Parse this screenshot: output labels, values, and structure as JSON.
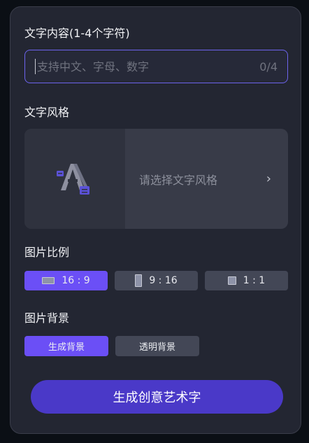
{
  "text_content": {
    "label": "文字内容(1-4个字符)",
    "placeholder": "支持中文、字母、数字",
    "value": "",
    "counter": "0/4"
  },
  "text_style": {
    "label": "文字风格",
    "placeholder": "请选择文字风格",
    "chevron": "›"
  },
  "image_ratio": {
    "label": "图片比例",
    "options": [
      {
        "label": "16 : 9",
        "selected": true
      },
      {
        "label": "9 : 16",
        "selected": false
      },
      {
        "label": "1 : 1",
        "selected": false
      }
    ]
  },
  "image_background": {
    "label": "图片背景",
    "options": [
      {
        "label": "生成背景",
        "selected": true
      },
      {
        "label": "透明背景",
        "selected": false
      }
    ]
  },
  "generate_button": {
    "label": "生成创意艺术字"
  },
  "colors": {
    "accent": "#6b4ff6",
    "generate": "#4a39c8",
    "panel": "#232632"
  }
}
